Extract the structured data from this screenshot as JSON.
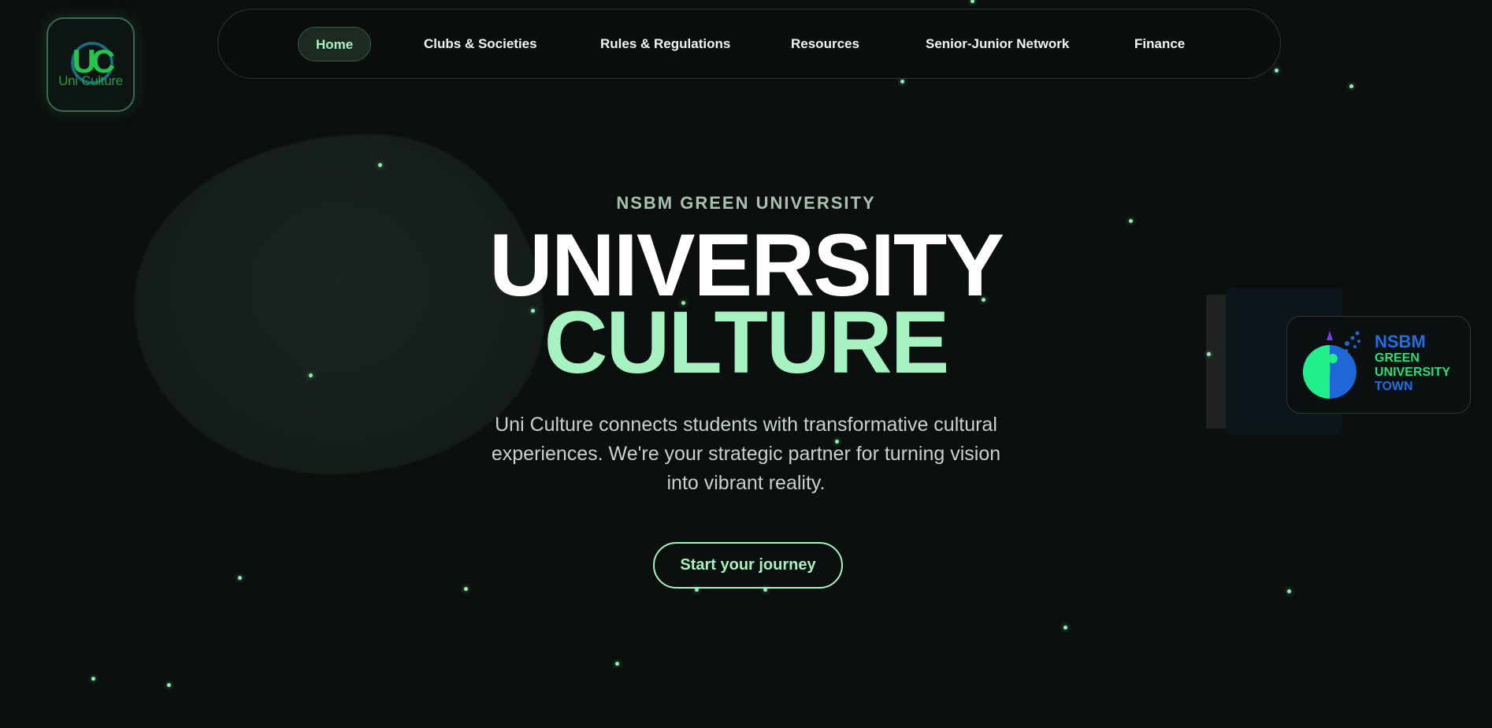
{
  "brand": {
    "logo_letters": "UC",
    "logo_sub": "Uni Culture"
  },
  "nav": {
    "items": [
      {
        "label": "Home",
        "active": true
      },
      {
        "label": "Clubs & Societies",
        "active": false
      },
      {
        "label": "Rules & Regulations",
        "active": false
      },
      {
        "label": "Resources",
        "active": false
      },
      {
        "label": "Senior-Junior Network",
        "active": false
      },
      {
        "label": "Finance",
        "active": false
      }
    ]
  },
  "hero": {
    "eyebrow": "NSBM GREEN UNIVERSITY",
    "title_line1": "UNIVERSITY",
    "title_line2": "CULTURE",
    "description": "Uni Culture connects students with transformative cultural experiences. We're your strategic partner for turning vision into vibrant reality.",
    "cta_label": "Start your journey"
  },
  "badge": {
    "line1": "NSBM",
    "line2": "GREEN",
    "line3": "UNIVERSITY",
    "line4": "TOWN"
  },
  "colors": {
    "background": "#0b0f0e",
    "accent": "#a6f2c0",
    "nsbm_blue": "#1e6fe6",
    "nsbm_green": "#22e07a"
  }
}
